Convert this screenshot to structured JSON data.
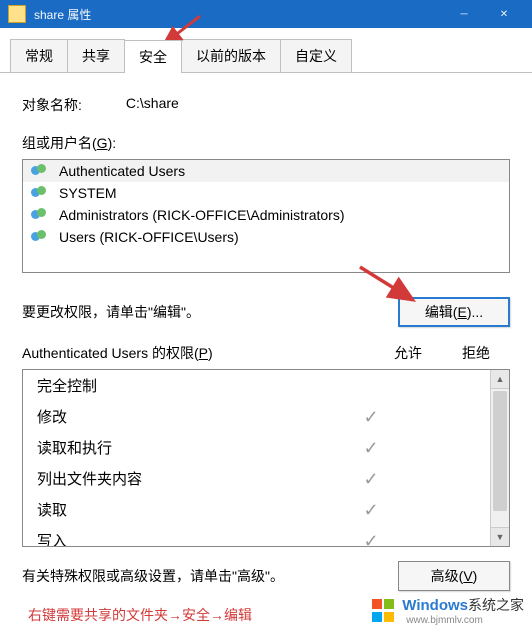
{
  "titlebar": {
    "title": "share 属性"
  },
  "tabs": [
    "常规",
    "共享",
    "安全",
    "以前的版本",
    "自定义"
  ],
  "active_tab": 2,
  "object": {
    "label": "对象名称:",
    "value": "C:\\share"
  },
  "groups": {
    "label": "组或用户名(",
    "mnemonic": "G",
    "label_end": "):",
    "items": [
      "Authenticated Users",
      "SYSTEM",
      "Administrators (RICK-OFFICE\\Administrators)",
      "Users (RICK-OFFICE\\Users)"
    ],
    "selected": 0
  },
  "edit": {
    "hint": "要更改权限，请单击\"编辑\"。",
    "button": "编辑(",
    "mnemonic": "E",
    "button_end": ")..."
  },
  "perm": {
    "header": "Authenticated Users 的权限(",
    "mnemonic": "P",
    "header_end": ")",
    "allow": "允许",
    "deny": "拒绝",
    "rows": [
      {
        "name": "完全控制",
        "allow": false,
        "deny": false
      },
      {
        "name": "修改",
        "allow": true,
        "deny": false
      },
      {
        "name": "读取和执行",
        "allow": true,
        "deny": false
      },
      {
        "name": "列出文件夹内容",
        "allow": true,
        "deny": false
      },
      {
        "name": "读取",
        "allow": true,
        "deny": false
      },
      {
        "name": "写入",
        "allow": true,
        "deny": false
      }
    ]
  },
  "advanced": {
    "hint": "有关特殊权限或高级设置，请单击\"高级\"。",
    "button": "高级(",
    "mnemonic": "V",
    "button_end": ")"
  },
  "note": "右键需要共享的文件夹→安全→编辑",
  "watermark": {
    "brand": "Windows",
    "sub": "系统之家",
    "url": "www.bjmmlv.com"
  }
}
